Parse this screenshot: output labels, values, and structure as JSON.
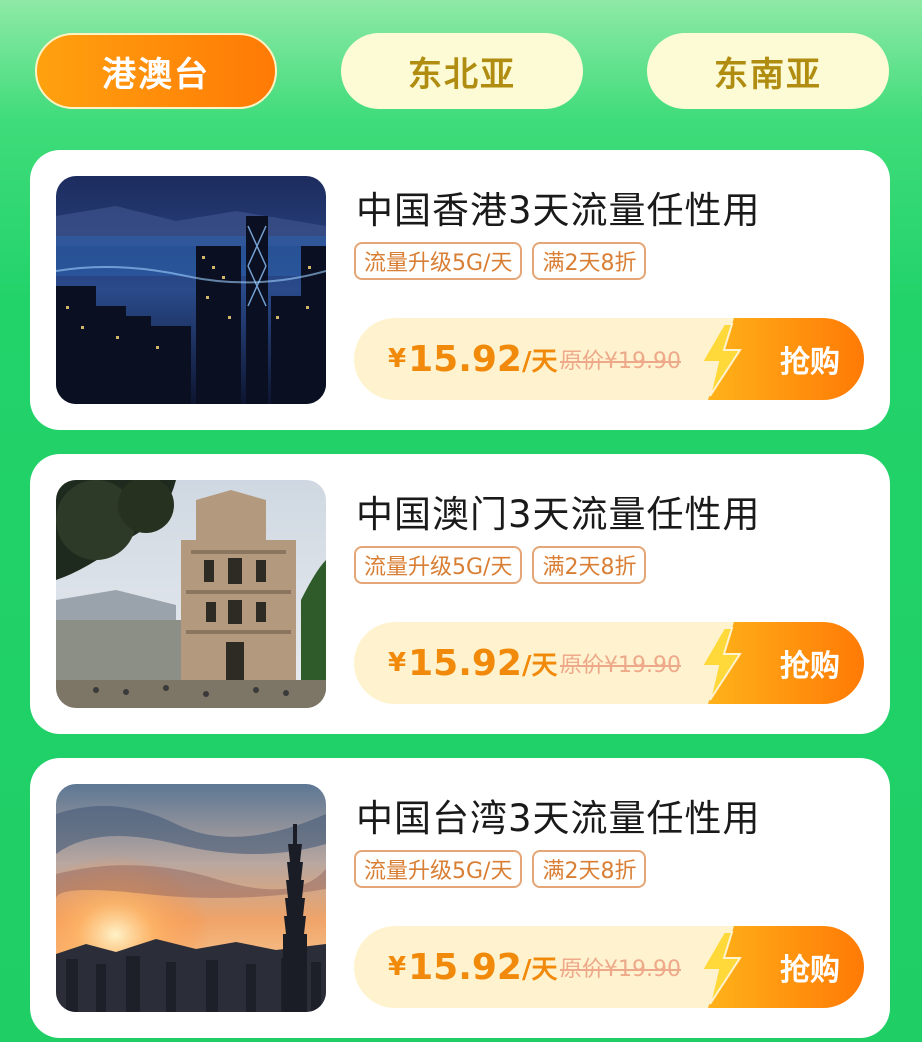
{
  "tabs": [
    {
      "label": "港澳台",
      "active": true
    },
    {
      "label": "东北亚",
      "active": false
    },
    {
      "label": "东南亚",
      "active": false
    }
  ],
  "colors": {
    "background": "#22d36a",
    "tab_active": "#ff8a08",
    "tab_inactive_bg": "#fdfbd6",
    "tag_border": "#e4a676",
    "price": "#f18a0b",
    "buy_button": "#ff8206"
  },
  "products": [
    {
      "image": "hong-kong-night-skyline-photo",
      "title": "中国香港3天流量任性用",
      "tags": [
        "流量升级5G/天",
        "满2天8折"
      ],
      "price_symbol": "¥",
      "price": "15.92",
      "price_unit": "/天",
      "original_price": "原价¥19.90",
      "buy_label": "抢购",
      "buy_icon": "lightning-icon"
    },
    {
      "image": "macau-st-pauls-ruins-photo",
      "title": "中国澳门3天流量任性用",
      "tags": [
        "流量升级5G/天",
        "满2天8折"
      ],
      "price_symbol": "¥",
      "price": "15.92",
      "price_unit": "/天",
      "original_price": "原价¥19.90",
      "buy_label": "抢购",
      "buy_icon": "lightning-icon"
    },
    {
      "image": "taipei-101-sunset-photo",
      "title": "中国台湾3天流量任性用",
      "tags": [
        "流量升级5G/天",
        "满2天8折"
      ],
      "price_symbol": "¥",
      "price": "15.92",
      "price_unit": "/天",
      "original_price": "原价¥19.90",
      "buy_label": "抢购",
      "buy_icon": "lightning-icon"
    }
  ]
}
